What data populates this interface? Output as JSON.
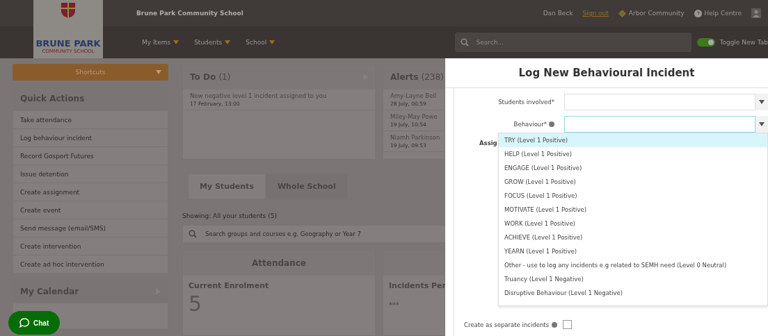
{
  "header": {
    "school_name": "Brune Park Community School",
    "logo_text": "BRUNE PARK",
    "logo_subtext": "COMMUNITY SCHOOL",
    "user": "Dan Beck",
    "sign_out": "Sign out",
    "links": [
      "Arbor Community",
      "Help Centre"
    ],
    "nav": [
      "My Items",
      "Students",
      "School"
    ],
    "search": {
      "placeholder": "Search..."
    },
    "toggle": {
      "label": "Toggle New Tab",
      "on": true
    }
  },
  "sidebar": {
    "shortcuts": "Shortcuts",
    "quick_actions": {
      "title": "Quick Actions",
      "items": [
        "Take attendance",
        "Log behaviour incident",
        "Record Gosport Futures",
        "Issue detention",
        "Create assignment",
        "Create event",
        "Send message (email/SMS)",
        "Create intervention",
        "Create ad hoc intervention"
      ]
    },
    "calendar": {
      "title": "My Calendar"
    }
  },
  "todo": {
    "title": "To Do",
    "count": "(1)",
    "items": [
      {
        "text": "New negative level 1 incident assigned to you",
        "time": "17 February, 13:00"
      }
    ]
  },
  "alerts": {
    "title": "Alerts",
    "count": "(238)",
    "items": [
      {
        "name": "Amy-Layne Bell",
        "time": "28 July, 00:59"
      },
      {
        "name": "Miley-May Powe",
        "time": "19 July, 10:54"
      },
      {
        "name": "Niamh Parkinson",
        "time": "19 July, 09:53"
      }
    ]
  },
  "tabs": [
    {
      "label": "My Students",
      "selected": true
    },
    {
      "label": "Whole School",
      "selected": false
    }
  ],
  "showing": "Showing: All your students (5)",
  "group_search": {
    "placeholder": "Search groups and courses e.g. Geography or Year 7"
  },
  "attendance": {
    "title": "Attendance",
    "metric": "Current Enrolment",
    "value": "5"
  },
  "incidents": {
    "metric": "Incidents Per",
    "value": "***"
  },
  "chat": "Chat",
  "modal": {
    "title": "Log New Behavioural Incident",
    "fields": [
      {
        "label": "Students involved*",
        "help": false,
        "focused": false
      },
      {
        "label": "Behaviour*",
        "help": true,
        "focused": true
      }
    ],
    "hidden_label": "Assig",
    "options": [
      {
        "label": "TRY (Level 1 Positive)",
        "selected": true
      },
      {
        "label": "HELP (Level 1 Positive)",
        "selected": false
      },
      {
        "label": "ENGAGE (Level 1 Positive)",
        "selected": false
      },
      {
        "label": "GROW (Level 1 Positive)",
        "selected": false
      },
      {
        "label": "FOCUS (Level 1 Positive)",
        "selected": false
      },
      {
        "label": "MOTIVATE (Level 1 Positive)",
        "selected": false
      },
      {
        "label": "WORK (Level 1 Positive)",
        "selected": false
      },
      {
        "label": "ACHIEVE (Level 1 Positive)",
        "selected": false
      },
      {
        "label": "YEARN (Level 1 Positive)",
        "selected": false
      },
      {
        "label": "Other - use to log any incidents e.g related to SEMH need (Level 0 Neutral)",
        "selected": false
      },
      {
        "label": "Truancy (Level 1 Negative)",
        "selected": false
      },
      {
        "label": "Disruptive Behaviour (Level 1 Negative)",
        "selected": false
      }
    ],
    "separate": {
      "label": "Create as separate incidents",
      "checked": false
    }
  }
}
